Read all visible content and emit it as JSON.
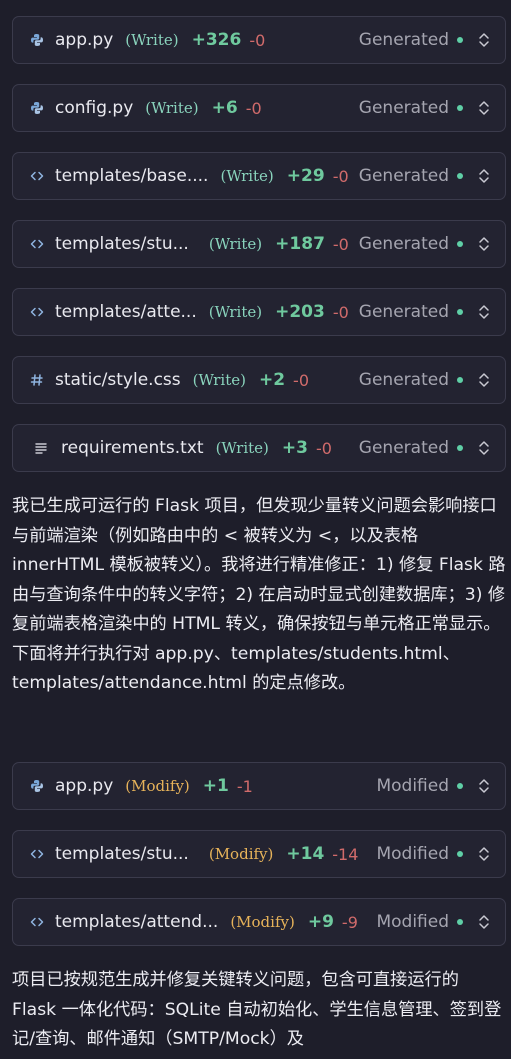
{
  "colors": {
    "background": "#1e1e2a",
    "card_background": "#232331",
    "card_border": "#3b3b4c",
    "write_tag": "#8ad4bd",
    "modify_tag": "#e7b35a",
    "additions": "#6fc99e",
    "deletions": "#d16b6b",
    "status_dot": "#5fcfa6"
  },
  "generated_files": [
    {
      "icon": "python-icon",
      "name": "app.py",
      "tag": "(Write)",
      "added": "+326",
      "removed": "-0",
      "status": "Generated"
    },
    {
      "icon": "python-icon",
      "name": "config.py",
      "tag": "(Write)",
      "added": "+6",
      "removed": "-0",
      "status": "Generated"
    },
    {
      "icon": "code-icon",
      "name": "templates/base....",
      "tag": "(Write)",
      "added": "+29",
      "removed": "-0",
      "status": "Generated"
    },
    {
      "icon": "code-icon",
      "name": "templates/stu...",
      "tag": "(Write)",
      "added": "+187",
      "removed": "-0",
      "status": "Generated"
    },
    {
      "icon": "code-icon",
      "name": "templates/atte...",
      "tag": "(Write)",
      "added": "+203",
      "removed": "-0",
      "status": "Generated"
    },
    {
      "icon": "hash-icon",
      "name": "static/style.css",
      "tag": "(Write)",
      "added": "+2",
      "removed": "-0",
      "status": "Generated"
    },
    {
      "icon": "text-lines-icon",
      "name": "requirements.txt",
      "tag": "(Write)",
      "added": "+3",
      "removed": "-0",
      "status": "Generated"
    }
  ],
  "message_1": "我已生成可运行的 Flask 项目，但发现少量转义问题会影响接口与前端渲染（例如路由中的 < 被转义为 <，以及表格 innerHTML 模板被转义）。我将进行精准修正：1) 修复 Flask 路由与查询条件中的转义字符；2) 在启动时显式创建数据库；3) 修复前端表格渲染中的 HTML 转义，确保按钮与单元格正常显示。下面将并行执行对 app.py、templates/students.html、templates/attendance.html 的定点修改。",
  "modified_files": [
    {
      "icon": "python-icon",
      "name": "app.py",
      "tag": "(Modify)",
      "added": "+1",
      "removed": "-1",
      "status": "Modified"
    },
    {
      "icon": "code-icon",
      "name": "templates/stu...",
      "tag": "(Modify)",
      "added": "+14",
      "removed": "-14",
      "status": "Modified"
    },
    {
      "icon": "code-icon",
      "name": "templates/attend...",
      "tag": "(Modify)",
      "added": "+9",
      "removed": "-9",
      "status": "Modified"
    }
  ],
  "message_2": "项目已按规范生成并修复关键转义问题，包含可直接运行的 Flask 一体化代码：SQLite 自动初始化、学生信息管理、签到登记/查询、邮件通知（SMTP/Mock）及"
}
